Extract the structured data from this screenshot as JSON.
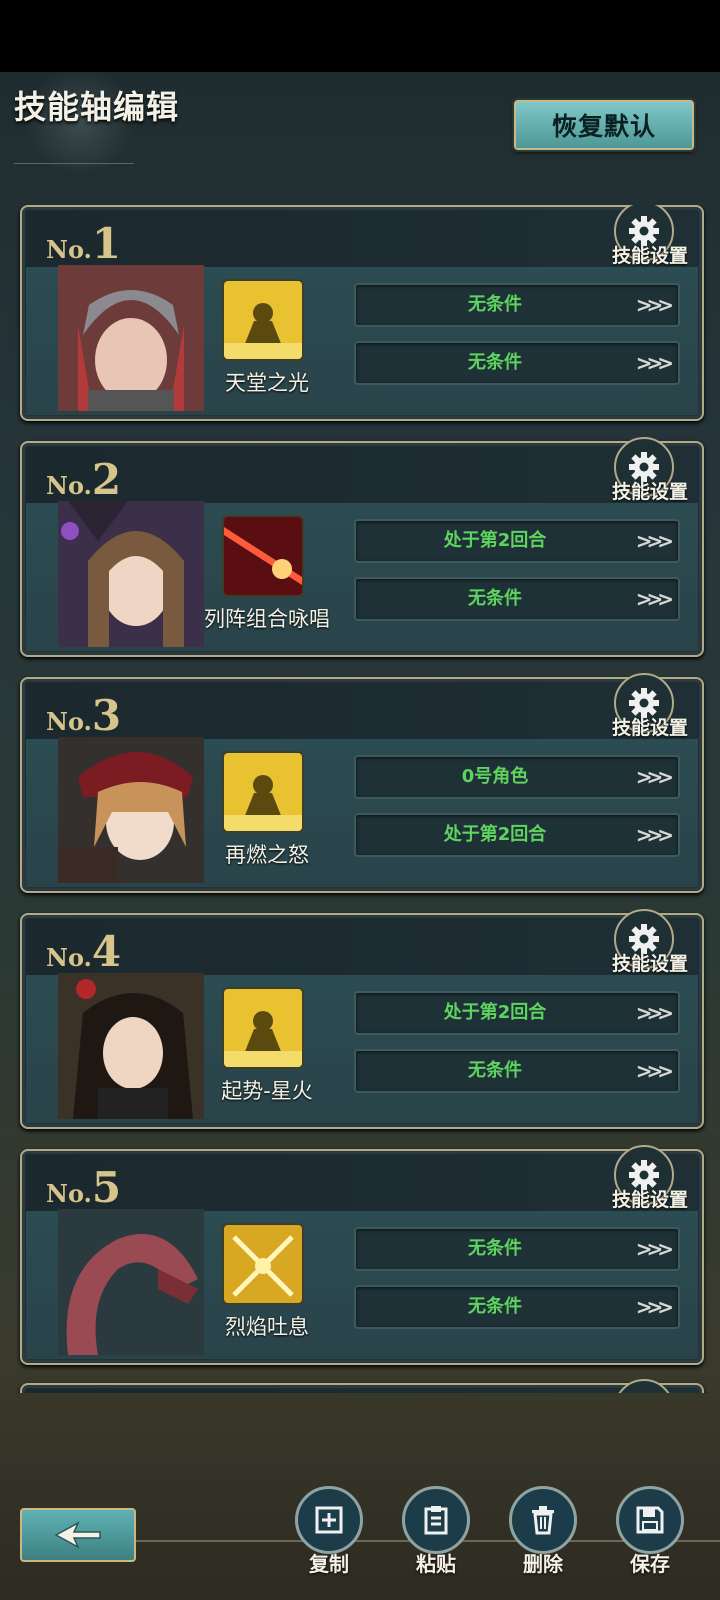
{
  "header": {
    "title": "技能轴编辑",
    "restore_label": "恢复默认"
  },
  "card_common": {
    "no_prefix": "No.",
    "gear_label": "技能设置"
  },
  "cards": [
    {
      "no": "1",
      "skill": "天堂之光",
      "cond1": "无条件",
      "cond2": "无条件",
      "icon": "golden-figure"
    },
    {
      "no": "2",
      "skill": "列阵组合咏唱",
      "cond1": "处于第2回合",
      "cond2": "无条件",
      "icon": "red-beam"
    },
    {
      "no": "3",
      "skill": "再燃之怒",
      "cond1": "0号角色",
      "cond2": "处于第2回合",
      "icon": "golden-figure"
    },
    {
      "no": "4",
      "skill": "起势-星火",
      "cond1": "处于第2回合",
      "cond2": "无条件",
      "icon": "golden-figure"
    },
    {
      "no": "5",
      "skill": "烈焰吐息",
      "cond1": "无条件",
      "cond2": "无条件",
      "icon": "crossed-swords"
    }
  ],
  "arrows": ">>>",
  "actions": {
    "copy": "复制",
    "paste": "粘贴",
    "delete": "删除",
    "save": "保存"
  },
  "colors": {
    "condition_text": "#5fd35f",
    "accent_gold": "#d6c48a",
    "restore_btn": "#6fb8b7"
  }
}
